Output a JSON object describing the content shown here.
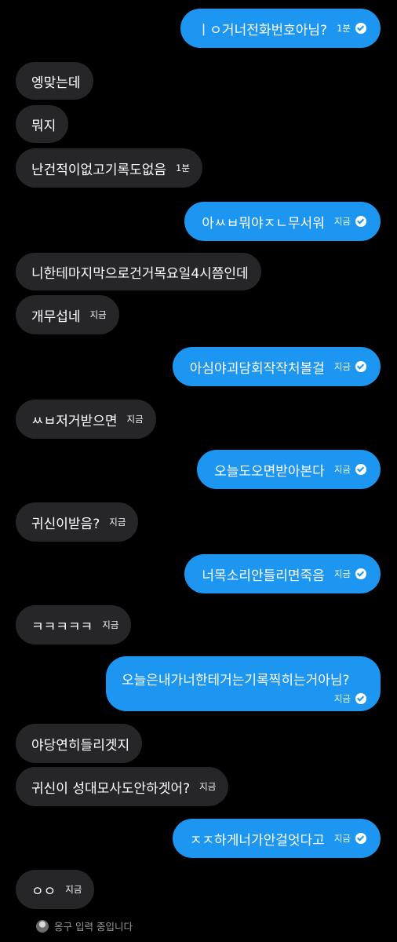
{
  "messages": [
    {
      "side": "sent",
      "text": "ㅣㅇ거너전화번호아님?",
      "time": "1분"
    },
    {
      "side": "recv",
      "text": "엥맞는데",
      "time": ""
    },
    {
      "side": "recv",
      "text": "뭐지",
      "time": ""
    },
    {
      "side": "recv",
      "text": "난건적이없고기록도없음",
      "time": "1분"
    },
    {
      "side": "sent",
      "text": "아ㅆㅂ뭐야ㅈㄴ무서워",
      "time": "지금"
    },
    {
      "side": "recv",
      "text": "니한테마지막으로건거목요일4시쯤인데",
      "time": ""
    },
    {
      "side": "recv",
      "text": "개무섭네",
      "time": "지금"
    },
    {
      "side": "sent",
      "text": "아심야괴담회작작처볼걸",
      "time": "지금"
    },
    {
      "side": "recv",
      "text": "ㅆㅂ저거받으면",
      "time": "지금"
    },
    {
      "side": "sent",
      "text": "오늘도오면받아본다",
      "time": "지금"
    },
    {
      "side": "recv",
      "text": "귀신이받음?",
      "time": "지금"
    },
    {
      "side": "sent",
      "text": "너목소리안들리면죽음",
      "time": "지금"
    },
    {
      "side": "recv",
      "text": "ㅋㅋㅋㅋㅋ",
      "time": "지금"
    },
    {
      "side": "sent",
      "text": "오늘은내가너한테거는기록찍히는거아님?",
      "time": "지금"
    },
    {
      "side": "recv",
      "text": "야당연히들리겟지",
      "time": ""
    },
    {
      "side": "recv",
      "text": "귀신이 성대모사도안하겟어?",
      "time": "지금"
    },
    {
      "side": "sent",
      "text": "ㅈㅈ하게너가안걸엇다고",
      "time": "지금"
    },
    {
      "side": "recv",
      "text": "ㅇㅇ",
      "time": "지금"
    }
  ],
  "typing": {
    "text": "옹구 입력 중입니다",
    "avatar_icon": "avatar"
  },
  "colors": {
    "sent_bubble": "#1c96f0",
    "recv_bubble": "#262628",
    "background": "#000000"
  }
}
